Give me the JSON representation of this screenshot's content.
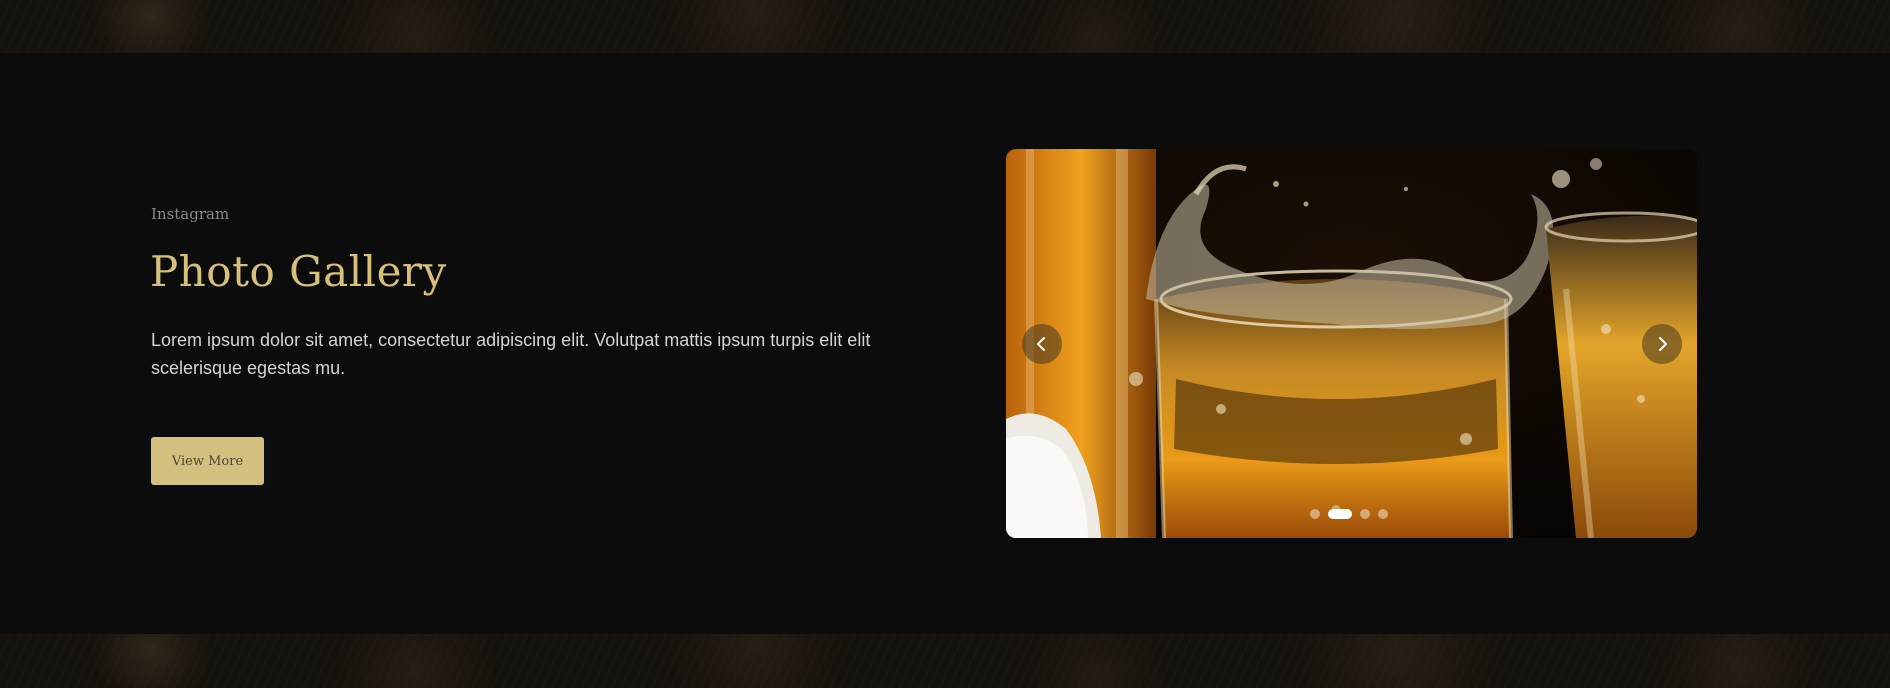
{
  "section": {
    "eyebrow": "Instagram",
    "title": "Photo Gallery",
    "description": "Lorem ipsum dolor sit amet, consectetur adipiscing elit. Volutpat mattis ipsum turpis elit elit scelerisque egestas mu.",
    "cta_label": "View More"
  },
  "carousel": {
    "image_subject": "whiskey glasses splashing",
    "prev_icon": "chevron-left-icon",
    "next_icon": "chevron-right-icon",
    "slide_count": 4,
    "active_slide": 2
  },
  "colors": {
    "background": "#0c0c0c",
    "accent_gold": "#d6c07a",
    "button_bg": "#d4c07e",
    "text_muted": "#8a8a8a",
    "text_body": "#d4d4d4"
  }
}
